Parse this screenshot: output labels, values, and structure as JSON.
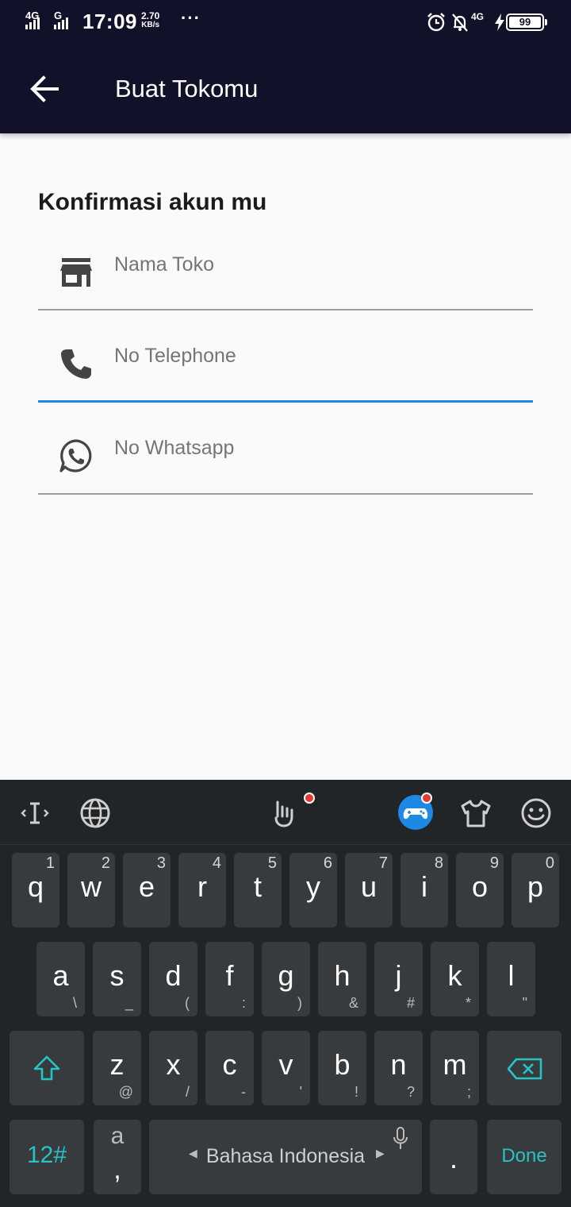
{
  "status_bar": {
    "net1": "4G",
    "net2": "G",
    "time": "17:09",
    "speed_value": "2.70",
    "speed_unit": "KB/s",
    "more": "···",
    "net3": "4G",
    "battery": "99"
  },
  "app_bar": {
    "title": "Buat Tokomu",
    "back_icon": "arrow-back-icon"
  },
  "form": {
    "title": "Konfirmasi akun mu",
    "fields": [
      {
        "icon": "store-icon",
        "placeholder": "Nama Toko",
        "focused": false
      },
      {
        "icon": "phone-icon",
        "placeholder": "No Telephone",
        "focused": true
      },
      {
        "icon": "whatsapp-icon",
        "placeholder": "No Whatsapp",
        "focused": false
      }
    ]
  },
  "colors": {
    "app_bar_bg": "#111129",
    "focus_underline": "#1e88e5",
    "keyboard_accent": "#28c4c4",
    "notification_dot": "#e53935"
  },
  "keyboard": {
    "toolbar_icons": [
      "text-cursor-icon",
      "globe-icon",
      "gesture-hand-icon",
      "game-controller-icon",
      "tshirt-icon",
      "smiley-icon"
    ],
    "row1": [
      {
        "k": "q",
        "n": "1"
      },
      {
        "k": "w",
        "n": "2"
      },
      {
        "k": "e",
        "n": "3"
      },
      {
        "k": "r",
        "n": "4"
      },
      {
        "k": "t",
        "n": "5"
      },
      {
        "k": "y",
        "n": "6"
      },
      {
        "k": "u",
        "n": "7"
      },
      {
        "k": "i",
        "n": "8"
      },
      {
        "k": "o",
        "n": "9"
      },
      {
        "k": "p",
        "n": "0"
      }
    ],
    "row2": [
      {
        "k": "a",
        "s": "\\"
      },
      {
        "k": "s",
        "s": "_"
      },
      {
        "k": "d",
        "s": "("
      },
      {
        "k": "f",
        "s": ":"
      },
      {
        "k": "g",
        "s": ")"
      },
      {
        "k": "h",
        "s": "&"
      },
      {
        "k": "j",
        "s": "#"
      },
      {
        "k": "k",
        "s": "*"
      },
      {
        "k": "l",
        "s": "\""
      }
    ],
    "row3": [
      {
        "k": "z",
        "s": "@"
      },
      {
        "k": "x",
        "s": "/"
      },
      {
        "k": "c",
        "s": "-"
      },
      {
        "k": "v",
        "s": "'"
      },
      {
        "k": "b",
        "s": "!"
      },
      {
        "k": "n",
        "s": "?"
      },
      {
        "k": "m",
        "s": ";"
      }
    ],
    "symbols_label": "12#",
    "comma_key_top": "a",
    "comma_key_bottom": ",",
    "space_label": "Bahasa Indonesia",
    "period_label": ".",
    "done_label": "Done"
  }
}
